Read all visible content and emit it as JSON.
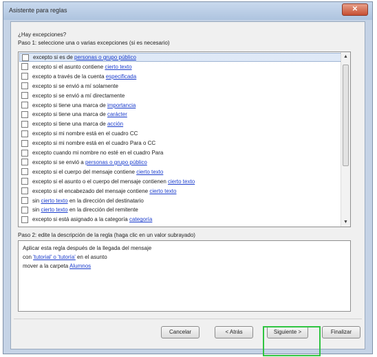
{
  "window": {
    "title": "Asistente para reglas",
    "close_glyph": "✕"
  },
  "step1": {
    "question": "¿Hay excepciones?",
    "label": "Paso 1: seleccione una o varias excepciones (si es necesario)",
    "items": [
      {
        "pre": "excepto si es de ",
        "link": "personas o grupo público",
        "post": ""
      },
      {
        "pre": "excepto si el asunto contiene ",
        "link": "cierto texto",
        "post": ""
      },
      {
        "pre": "excepto a través de la cuenta ",
        "link": "especificada",
        "post": ""
      },
      {
        "pre": "excepto si se envió a mí solamente",
        "link": "",
        "post": ""
      },
      {
        "pre": "excepto si se envió a mí directamente",
        "link": "",
        "post": ""
      },
      {
        "pre": "excepto si tiene una marca de ",
        "link": "importancia",
        "post": ""
      },
      {
        "pre": "excepto si tiene una marca de ",
        "link": "carácter",
        "post": ""
      },
      {
        "pre": "excepto si tiene una marca de ",
        "link": "acción",
        "post": ""
      },
      {
        "pre": "excepto si mi nombre está en el cuadro CC",
        "link": "",
        "post": ""
      },
      {
        "pre": "excepto si mi nombre está en el cuadro Para o CC",
        "link": "",
        "post": ""
      },
      {
        "pre": "excepto cuando mi nombre no esté en el cuadro Para",
        "link": "",
        "post": ""
      },
      {
        "pre": "excepto si se envió a ",
        "link": "personas o grupo público",
        "post": ""
      },
      {
        "pre": "excepto si el cuerpo del mensaje contiene ",
        "link": "cierto texto",
        "post": ""
      },
      {
        "pre": "excepto si el asunto o el cuerpo del mensaje contienen ",
        "link": "cierto texto",
        "post": ""
      },
      {
        "pre": "excepto si el encabezado del mensaje contiene ",
        "link": "cierto texto",
        "post": ""
      },
      {
        "pre": "sin ",
        "link": "cierto texto",
        "post": " en la dirección del destinatario"
      },
      {
        "pre": "sin ",
        "link": "cierto texto",
        "post": " en la dirección del remitente"
      },
      {
        "pre": "excepto si está asignado a la categoría ",
        "link": "categoría",
        "post": ""
      }
    ]
  },
  "step2": {
    "label": "Paso 2: edite la descripción de la regla (haga clic en un valor subrayado)",
    "lines": [
      {
        "pre": "Aplicar esta regla después de la llegada del mensaje",
        "link": "",
        "post": ""
      },
      {
        "pre": "con ",
        "link": "'tutorial' o 'tutoría'",
        "post": " en el asunto"
      },
      {
        "pre": "mover a la carpeta ",
        "link": "Alumnos",
        "post": ""
      }
    ]
  },
  "buttons": {
    "cancel": "Cancelar",
    "back": "< Atrás",
    "next": "Siguiente >",
    "finish": "Finalizar"
  },
  "colors": {
    "highlight": "#2fc440",
    "link": "#1a3ccc"
  }
}
